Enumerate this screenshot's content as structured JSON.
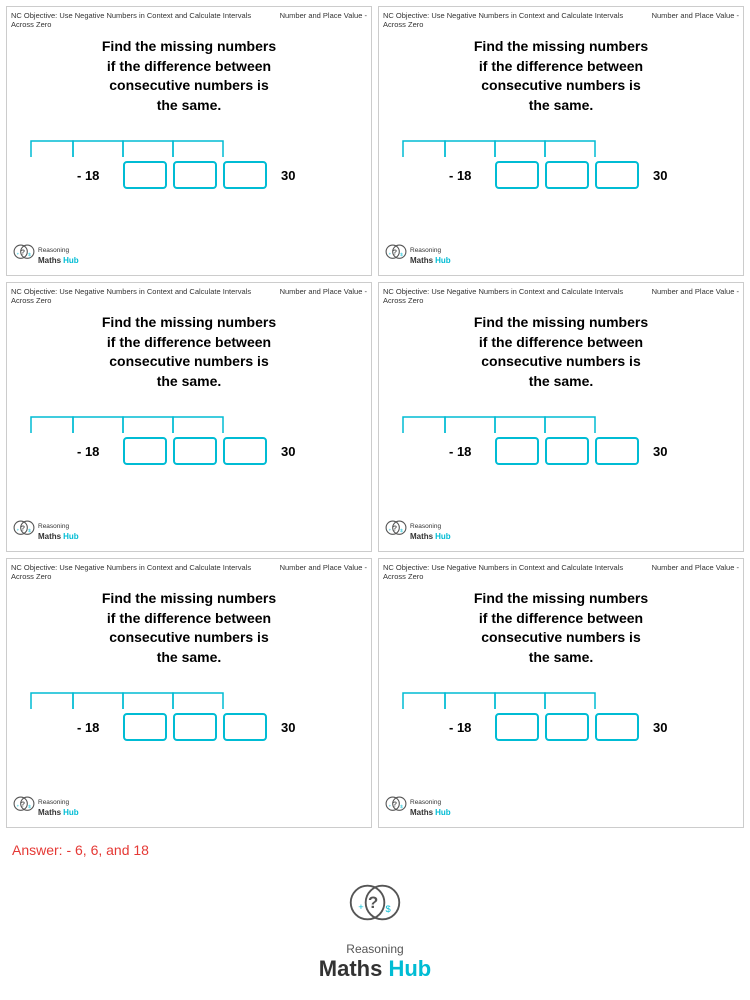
{
  "cards": [
    {
      "id": "card-1",
      "topic": "Number and Place Value -",
      "objective": "NC Objective: Use Negative Numbers in Context and Calculate Intervals Across Zero",
      "question_line1": "Find the missing numbers",
      "question_line2": "if the difference between",
      "question_line3": "consecutive numbers is",
      "question_line4": "the same.",
      "start": "- 18",
      "end": "30",
      "box_count": 3
    },
    {
      "id": "card-2",
      "topic": "Number and Place Value -",
      "objective": "NC Objective: Use Negative Numbers in Context and Calculate Intervals Across Zero",
      "question_line1": "Find the missing numbers",
      "question_line2": "if the difference between",
      "question_line3": "consecutive numbers is",
      "question_line4": "the same.",
      "start": "- 18",
      "end": "30",
      "box_count": 3
    },
    {
      "id": "card-3",
      "topic": "Number and Place Value -",
      "objective": "NC Objective: Use Negative Numbers in Context and Calculate Intervals Across Zero",
      "question_line1": "Find the missing numbers",
      "question_line2": "if the difference between",
      "question_line3": "consecutive numbers is",
      "question_line4": "the same.",
      "start": "- 18",
      "end": "30",
      "box_count": 3
    },
    {
      "id": "card-4",
      "topic": "Number and Place Value -",
      "objective": "NC Objective: Use Negative Numbers in Context and Calculate Intervals Across Zero",
      "question_line1": "Find the missing numbers",
      "question_line2": "if the difference between",
      "question_line3": "consecutive numbers is",
      "question_line4": "the same.",
      "start": "- 18",
      "end": "30",
      "box_count": 3
    },
    {
      "id": "card-5",
      "topic": "Number and Place Value -",
      "objective": "NC Objective: Use Negative Numbers in Context and Calculate Intervals Across Zero",
      "question_line1": "Find the missing numbers",
      "question_line2": "if the difference between",
      "question_line3": "consecutive numbers is",
      "question_line4": "the same.",
      "start": "- 18",
      "end": "30",
      "box_count": 3
    },
    {
      "id": "card-6",
      "topic": "Number and Place Value -",
      "objective": "NC Objective: Use Negative Numbers in Context and Calculate Intervals Across Zero",
      "question_line1": "Find the missing numbers",
      "question_line2": "if the difference between",
      "question_line3": "consecutive numbers is",
      "question_line4": "the same.",
      "start": "- 18",
      "end": "30",
      "box_count": 3
    }
  ],
  "answer": {
    "label": "Answer: - 6, 6, and 18"
  },
  "logo": {
    "reasoning": "Reasoning",
    "maths": "Maths",
    "hub": "Hub"
  }
}
